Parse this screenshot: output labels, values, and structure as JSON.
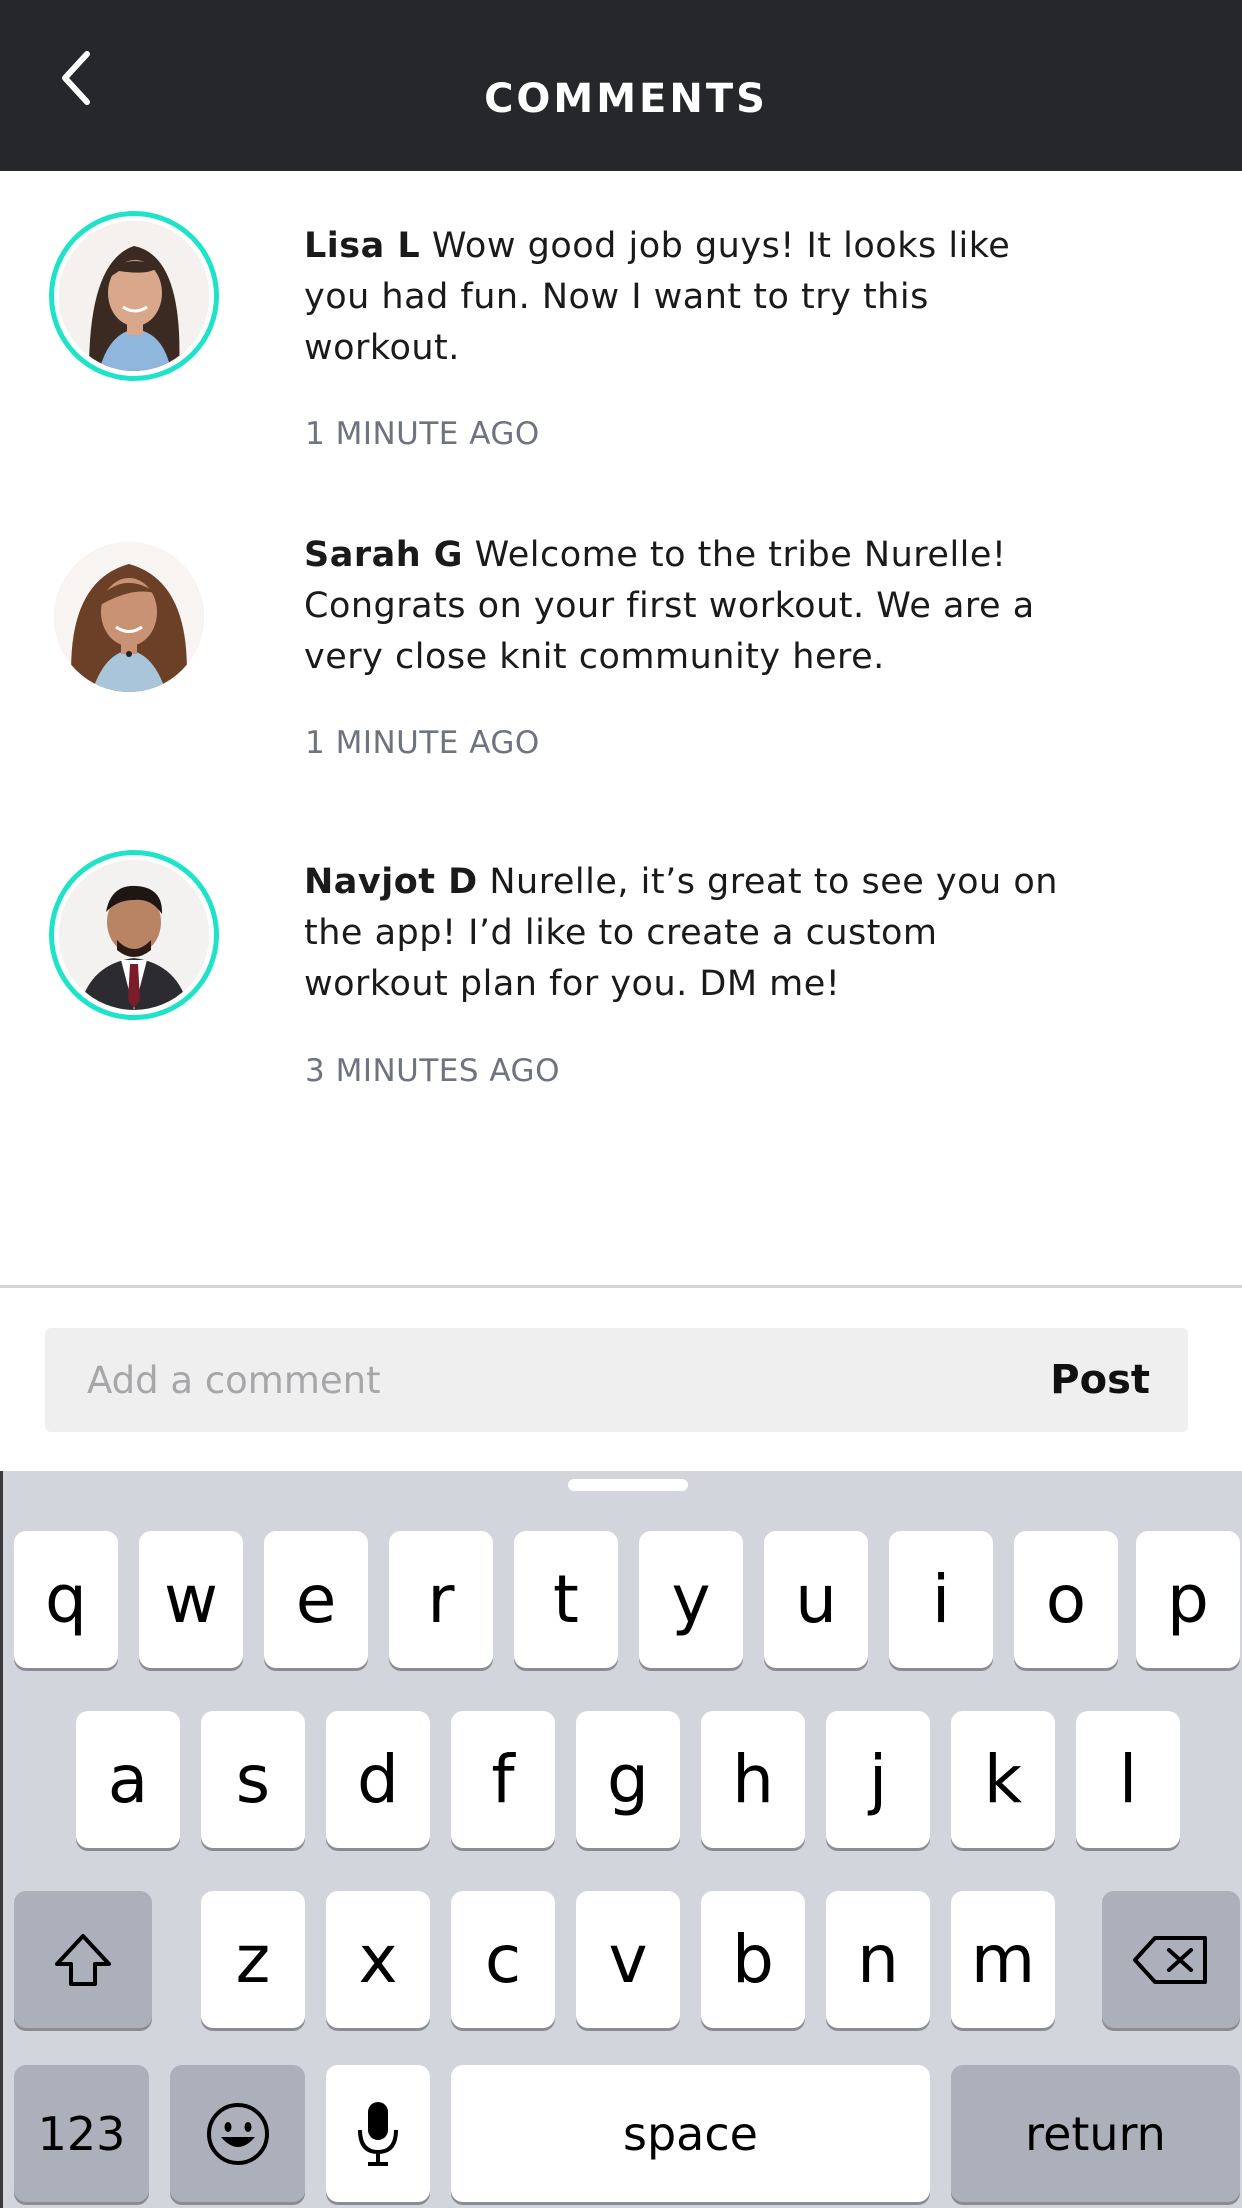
{
  "header": {
    "title": "COMMENTS",
    "back_icon": "chevron-left-icon"
  },
  "comments": [
    {
      "author": "Lisa L",
      "text": " Wow good job guys! It looks like you had fun. Now I want to try this workout.",
      "time": "1 MINUTE AGO",
      "ring": true
    },
    {
      "author": "Sarah G",
      "text": " Welcome to the tribe Nurelle! Congrats on your first workout. We are a very close knit community here.",
      "time": "1 MINUTE AGO",
      "ring": false
    },
    {
      "author": "Navjot D",
      "text": " Nurelle, it’s great to see you on the app! I’d like to create a custom workout plan for you. DM me!",
      "time": "3 MINUTES AGO",
      "ring": true
    }
  ],
  "composer": {
    "placeholder": "Add a comment",
    "post_label": "Post"
  },
  "keyboard": {
    "row1": [
      "q",
      "w",
      "e",
      "r",
      "t",
      "y",
      "u",
      "i",
      "o",
      "p"
    ],
    "row2": [
      "a",
      "s",
      "d",
      "f",
      "g",
      "h",
      "j",
      "k",
      "l"
    ],
    "row3": [
      "z",
      "x",
      "c",
      "v",
      "b",
      "n",
      "m"
    ],
    "numbers_label": "123",
    "space_label": "space",
    "return_label": "return"
  },
  "colors": {
    "header_bg": "#26272b",
    "ring": "#1ee3c8",
    "keyboard_bg": "#d2d5db"
  }
}
